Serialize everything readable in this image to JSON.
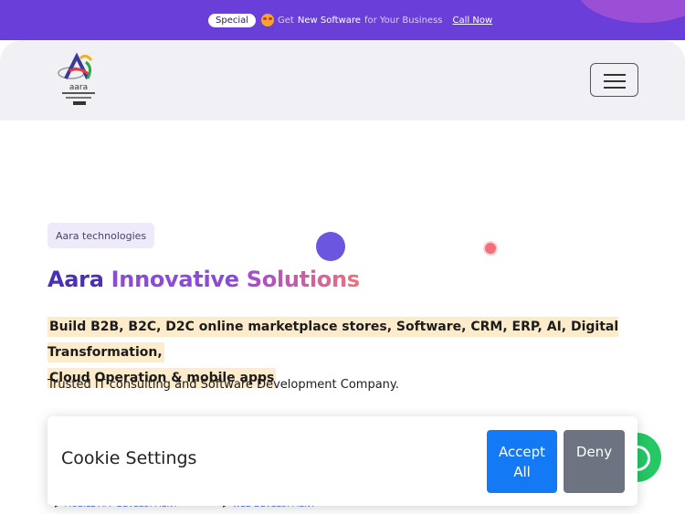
{
  "topbar": {
    "badge": "Special",
    "text_prefix": "Get",
    "text_strong": "New Software",
    "text_suffix": "for Your Business",
    "cta": "Call Now"
  },
  "header": {
    "logo_text": "aara technologies",
    "menu_icon": "hamburger-icon"
  },
  "hero": {
    "chip": "Aara technologies",
    "title": {
      "word1": "Aara",
      "word2": "Innovative",
      "word3": "Solutions"
    },
    "highlight_line1": "Build B2B, B2C, D2C online marketplace stores, Software, CRM, ERP, AI, Digital Transformation,",
    "highlight_line2": "Cloud Operation & mobile apps",
    "tagline": "Trusted IT consulting and Software Development Company."
  },
  "list_partial": {
    "item1": "MOBILE APP DEVELOPMENT",
    "item2": "WEB DEVELOPMENT"
  },
  "cookie": {
    "title": "Cookie Settings",
    "accept_line1": "Accept",
    "accept_line2": "All",
    "deny": "Deny"
  },
  "colors": {
    "brand_purple": "#6a3ed8",
    "accept_blue": "#1479f5",
    "deny_gray": "#6d7380",
    "whatsapp_green": "#25c864"
  }
}
